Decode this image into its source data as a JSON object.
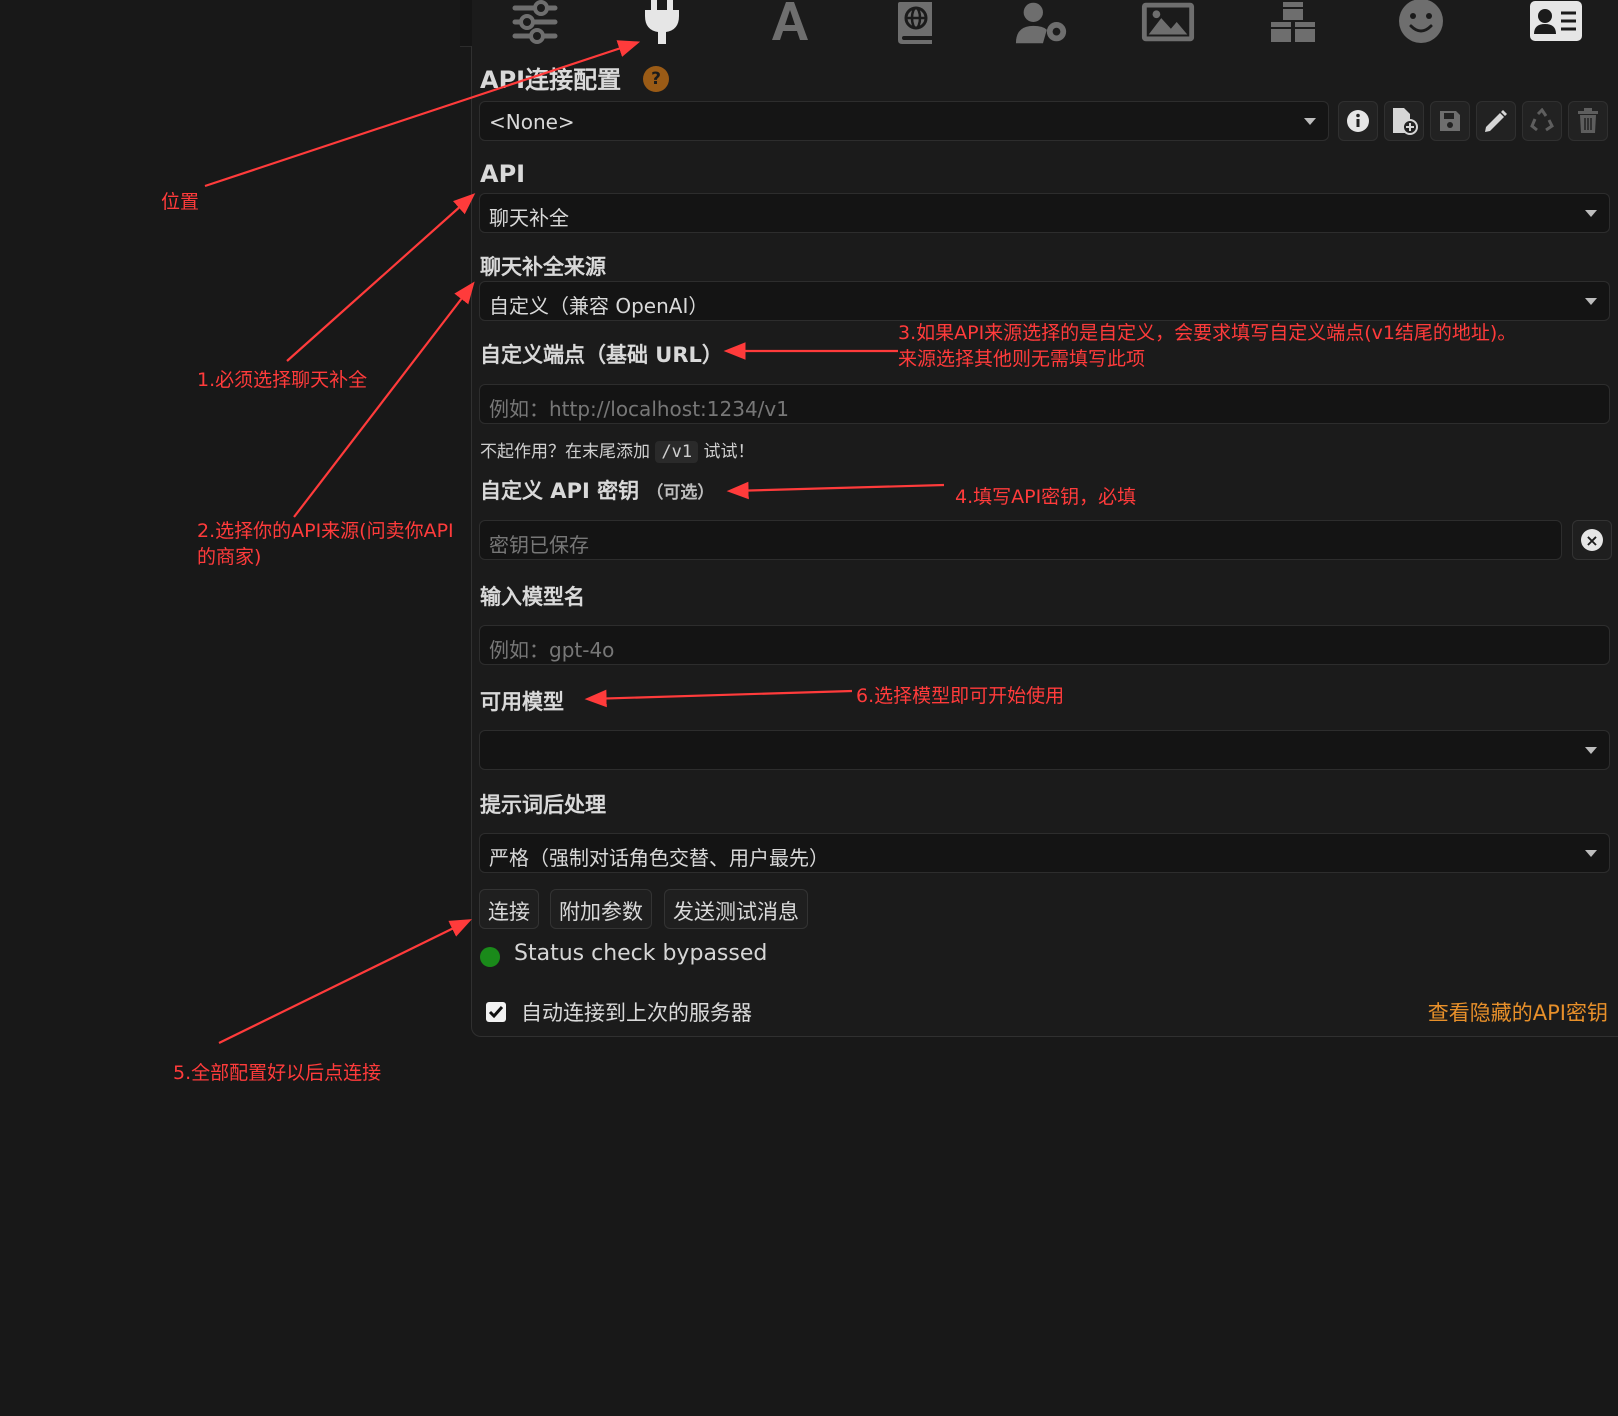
{
  "nav": {
    "icons": [
      "sliders-icon",
      "plug-icon",
      "font-icon",
      "book-atlas-icon",
      "user-gear-icon",
      "image-icon",
      "cubes-icon",
      "smiley-icon",
      "contact-card-icon"
    ]
  },
  "connection_profile": {
    "heading": "API连接配置",
    "help": "?",
    "selected": "<None>",
    "buttons": [
      "info-icon",
      "file-plus-icon",
      "save-icon",
      "pencil-icon",
      "recycle-icon",
      "trash-icon"
    ]
  },
  "api": {
    "heading": "API",
    "selected": "聊天补全"
  },
  "source": {
    "heading": "聊天补全来源",
    "selected": "自定义（兼容 OpenAI）"
  },
  "endpoint": {
    "heading": "自定义端点（基础 URL）",
    "placeholder": "例如：http://localhost:1234/v1",
    "hint_prefix": "不起作用？在末尾添加",
    "hint_code": "/v1",
    "hint_suffix": "试试！"
  },
  "api_key": {
    "heading": "自定义 API 密钥",
    "optional": "（可选）",
    "placeholder": "密钥已保存",
    "clear": "×"
  },
  "model_input": {
    "heading": "输入模型名",
    "placeholder": "例如：gpt-4o"
  },
  "available_models": {
    "heading": "可用模型",
    "selected": ""
  },
  "prompt_processing": {
    "heading": "提示词后处理",
    "selected": "严格（强制对话角色交替、用户最先）"
  },
  "actions": {
    "connect": "连接",
    "extra_params": "附加参数",
    "send_test": "发送测试消息"
  },
  "status": {
    "text": "Status check bypassed",
    "color": "#1a8a1a"
  },
  "auto_connect": {
    "label": "自动连接到上次的服务器",
    "checked": true
  },
  "view_hidden_keys": "查看隐藏的API密钥",
  "annotations": {
    "position": "位置",
    "a1": "1.必须选择聊天补全",
    "a2": "2.选择你的API来源(问卖你API的商家)",
    "a3_line1": "3.如果API来源选择的是自定义，会要求填写自定义端点(v1结尾的地址)。",
    "a3_line2": "来源选择其他则无需填写此项",
    "a4": "4.填写API密钥，必填",
    "a5": "5.全部配置好以后点连接",
    "a6": "6.选择模型即可开始使用"
  },
  "colors": {
    "background": "#181818",
    "panel": "#1b1b1b",
    "annotation": "#ff3b3b",
    "link": "#e8902a",
    "help_badge": "#9a5b16"
  }
}
